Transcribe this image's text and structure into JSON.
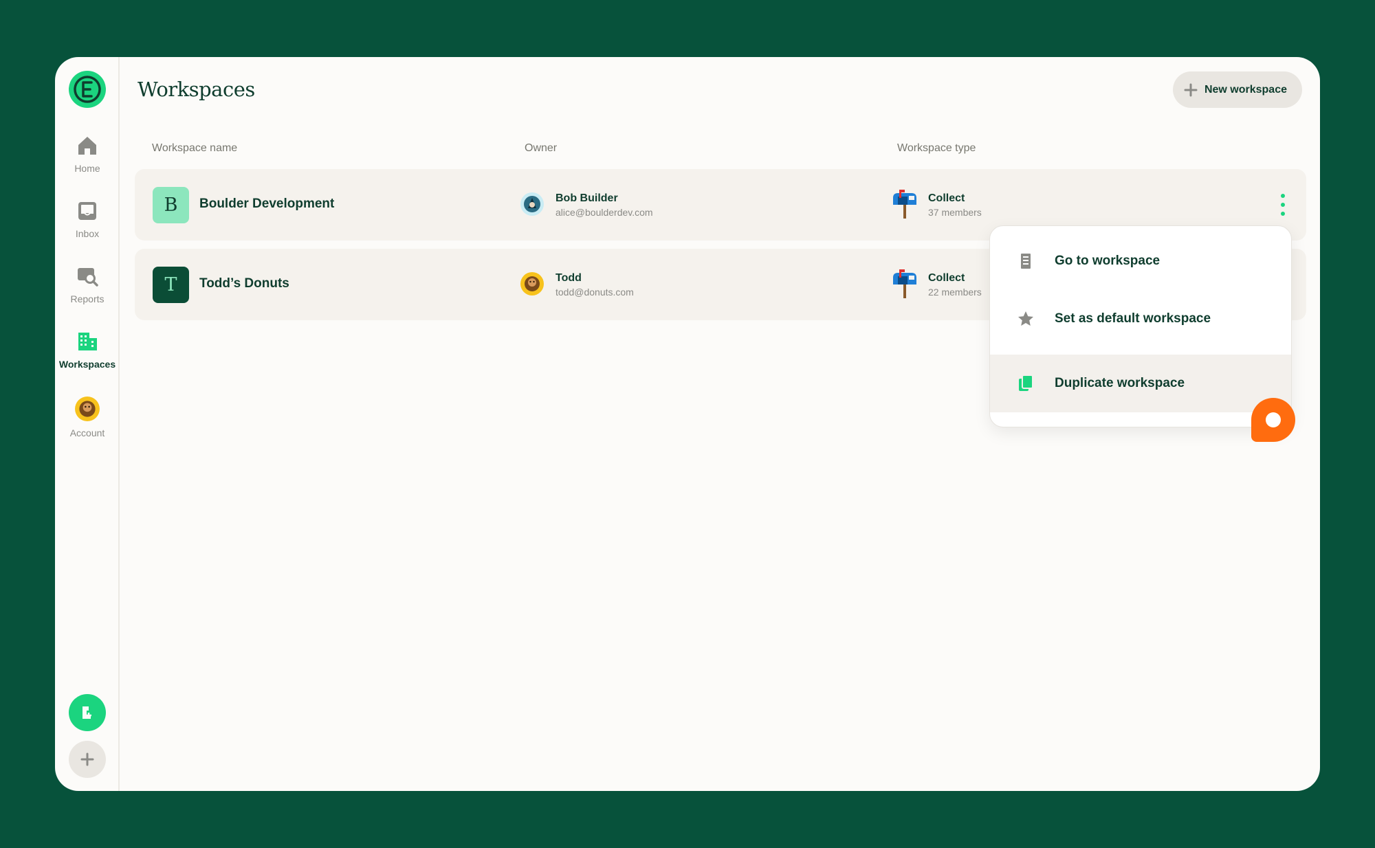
{
  "app": {
    "logo_letter": "E"
  },
  "sidebar": {
    "items": [
      {
        "id": "home",
        "label": "Home",
        "icon": "home-icon",
        "active": false
      },
      {
        "id": "inbox",
        "label": "Inbox",
        "icon": "inbox-icon",
        "active": false
      },
      {
        "id": "reports",
        "label": "Reports",
        "icon": "reports-icon",
        "active": false
      },
      {
        "id": "workspaces",
        "label": "Workspaces",
        "icon": "building-icon",
        "active": true
      },
      {
        "id": "account",
        "label": "Account",
        "icon": "avatar-icon",
        "active": false
      }
    ],
    "bottom": [
      {
        "id": "new-expense",
        "icon": "new-expense-icon"
      },
      {
        "id": "add",
        "icon": "plus-icon"
      }
    ]
  },
  "header": {
    "title": "Workspaces",
    "new_button_label": "New workspace"
  },
  "table": {
    "columns": [
      "Workspace name",
      "Owner",
      "Workspace type"
    ],
    "rows": [
      {
        "badge": "B",
        "name": "Boulder Development",
        "owner_name": "Bob Builder",
        "owner_email": "alice@boulderdev.com",
        "type": "Collect",
        "members": "37 members",
        "badge_bg": "#8ce6bd",
        "badge_fg": "#0f3d2e"
      },
      {
        "badge": "T",
        "name": "Todd’s Donuts",
        "owner_name": "Todd",
        "owner_email": "todd@donuts.com",
        "type": "Collect",
        "members": "22 members",
        "badge_bg": "#0b4d36",
        "badge_fg": "#8ce6bd"
      }
    ]
  },
  "menu": {
    "items": [
      {
        "label": "Go to workspace",
        "icon": "building-icon"
      },
      {
        "label": "Set as default workspace",
        "icon": "star-icon"
      },
      {
        "label": "Duplicate workspace",
        "icon": "copy-icon",
        "highlighted": true
      }
    ]
  },
  "colors": {
    "background": "#07523b",
    "accent": "#1bd47f",
    "cursor": "#ff6c0f"
  }
}
